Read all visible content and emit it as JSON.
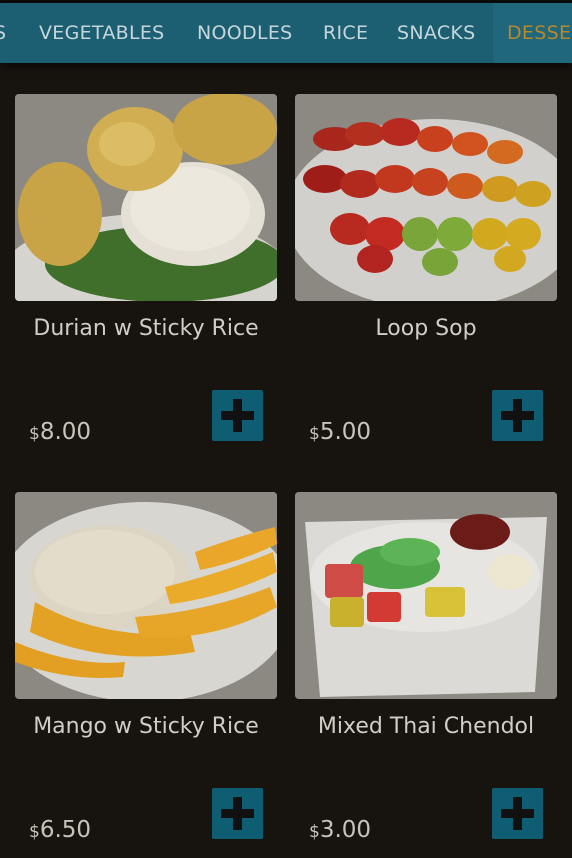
{
  "nav": {
    "tabs": [
      {
        "label": "S",
        "active": false
      },
      {
        "label": "VEGETABLES",
        "active": false
      },
      {
        "label": "NOODLES",
        "active": false
      },
      {
        "label": "RICE",
        "active": false
      },
      {
        "label": "SNACKS",
        "active": false
      },
      {
        "label": "DESSE",
        "active": true
      }
    ]
  },
  "products": [
    {
      "name": "Durian w Sticky Rice",
      "currency": "$",
      "price": "8.00",
      "image": "durian-sticky-rice"
    },
    {
      "name": "Loop Sop",
      "currency": "$",
      "price": "5.00",
      "image": "loop-sop"
    },
    {
      "name": "Mango w Sticky Rice",
      "currency": "$",
      "price": "6.50",
      "image": "mango-sticky-rice"
    },
    {
      "name": "Mixed Thai Chendol",
      "currency": "$",
      "price": "3.00",
      "image": "mixed-thai-chendol"
    }
  ],
  "colors": {
    "background": "#17130f",
    "navbar": "#1d5f72",
    "active_tab": "#b7882c",
    "add_button": "#0f5d72"
  }
}
